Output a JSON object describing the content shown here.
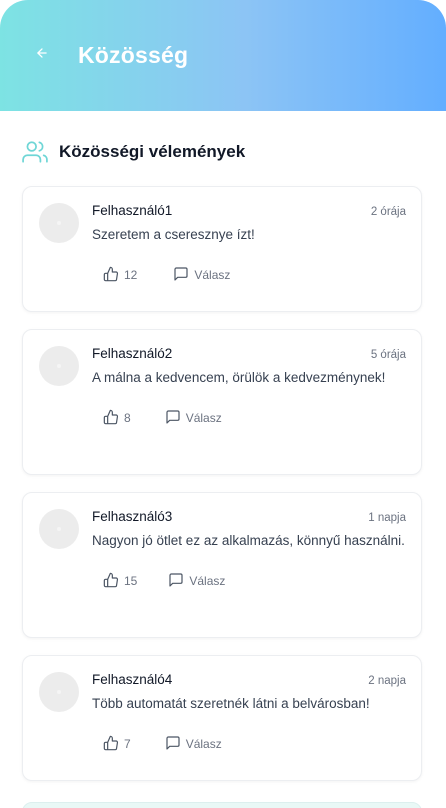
{
  "header": {
    "title": "Közösség"
  },
  "section": {
    "title": "Közösségi vélemények"
  },
  "comments": [
    {
      "user": "Felhasználó1",
      "time": "2 órája",
      "text": "Szeretem a cseresznye ízt!",
      "likes": "12",
      "reply_label": "Válasz"
    },
    {
      "user": "Felhasználó2",
      "time": "5 órája",
      "text": "A málna a kedvencem, örülök a kedvezménynek!",
      "likes": "8",
      "reply_label": "Válasz"
    },
    {
      "user": "Felhasználó3",
      "time": "1 napja",
      "text": "Nagyon jó ötlet ez az alkalmazás, könnyű használni.",
      "likes": "15",
      "reply_label": "Válasz"
    },
    {
      "user": "Felhasználó4",
      "time": "2 napja",
      "text": "Több automatát szeretnék látni a belvárosban!",
      "likes": "7",
      "reply_label": "Válasz"
    }
  ],
  "colors": {
    "header_start": "#7de3e3",
    "header_end": "#63aeff",
    "accent_icon": "#6fd6d6"
  },
  "icons": {
    "back": "arrow-left-icon",
    "section": "users-icon",
    "like": "thumbs-up-icon",
    "reply": "message-square-icon"
  }
}
